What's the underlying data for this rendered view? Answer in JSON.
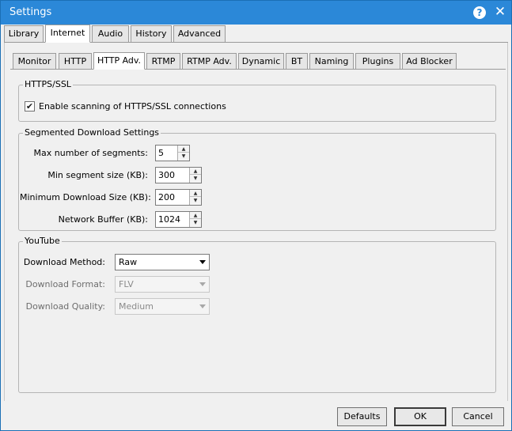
{
  "window": {
    "title": "Settings",
    "help_glyph": "?",
    "close_glyph": "✕"
  },
  "main_tabs": [
    {
      "label": "Library",
      "active": false
    },
    {
      "label": "Internet",
      "active": true
    },
    {
      "label": "Audio",
      "active": false
    },
    {
      "label": "History",
      "active": false
    },
    {
      "label": "Advanced",
      "active": false
    }
  ],
  "sub_tabs": [
    {
      "label": "Monitor",
      "active": false
    },
    {
      "label": "HTTP",
      "active": false
    },
    {
      "label": "HTTP Adv.",
      "active": true
    },
    {
      "label": "RTMP",
      "active": false
    },
    {
      "label": "RTMP Adv.",
      "active": false
    },
    {
      "label": "Dynamic",
      "active": false
    },
    {
      "label": "BT",
      "active": false
    },
    {
      "label": "Naming",
      "active": false
    },
    {
      "label": "Plugins",
      "active": false
    },
    {
      "label": "Ad Blocker",
      "active": false
    }
  ],
  "https_ssl": {
    "legend": "HTTPS/SSL",
    "enable_scanning": {
      "label": "Enable scanning of HTTPS/SSL connections",
      "checked": true,
      "glyph": "✔"
    }
  },
  "segmented": {
    "legend": "Segmented Download Settings",
    "fields": [
      {
        "label": "Max number of segments:",
        "value": "5"
      },
      {
        "label": "Min segment size (KB):",
        "value": "300"
      },
      {
        "label": "Minimum Download Size (KB):",
        "value": "200"
      },
      {
        "label": "Network Buffer (KB):",
        "value": "1024"
      }
    ]
  },
  "youtube": {
    "legend": "YouTube",
    "method": {
      "label": "Download Method:",
      "value": "Raw",
      "enabled": true
    },
    "format": {
      "label": "Download Format:",
      "value": "FLV",
      "enabled": false
    },
    "quality": {
      "label": "Download Quality:",
      "value": "Medium",
      "enabled": false
    }
  },
  "footer": {
    "defaults_label": "Defaults",
    "ok_label": "OK",
    "cancel_label": "Cancel"
  },
  "colors": {
    "titlebar": "#2b88d8",
    "window_bg": "#f0f0f0"
  },
  "icons": {
    "spin_up": "▲",
    "spin_down": "▼"
  }
}
